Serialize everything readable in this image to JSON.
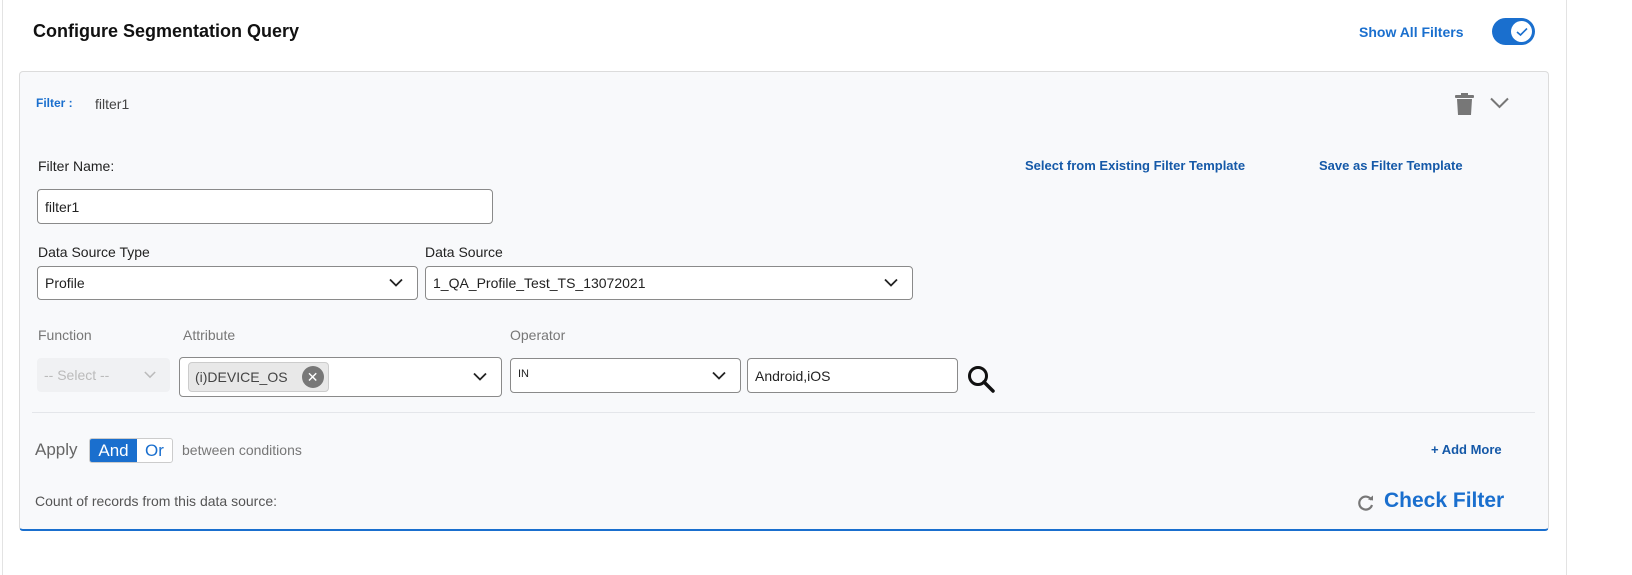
{
  "header": {
    "title": "Configure Segmentation Query",
    "show_all_filters": "Show All Filters",
    "toggle_on": true
  },
  "filter": {
    "label": "Filter :",
    "name": "filter1",
    "name_label": "Filter Name:",
    "name_value": "filter1",
    "select_template": "Select from Existing Filter Template",
    "save_template": "Save as Filter Template",
    "data_source_type_label": "Data Source Type",
    "data_source_type_value": "Profile",
    "data_source_label": "Data Source",
    "data_source_value": "1_QA_Profile_Test_TS_13072021",
    "function_label": "Function",
    "function_placeholder": "-- Select --",
    "attribute_label": "Attribute",
    "attribute_chip": "(i)DEVICE_OS",
    "operator_label": "Operator",
    "operator_value": "IN",
    "value": "Android,iOS",
    "apply": "Apply",
    "and": "And",
    "or": "Or",
    "between": "between conditions",
    "add_more": "+ Add More",
    "count_label": "Count of records from this data source:",
    "check_filter": "Check Filter"
  }
}
